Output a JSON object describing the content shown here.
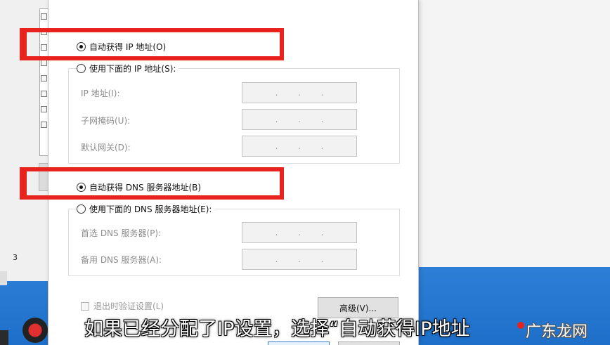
{
  "background": {
    "side_number": "3"
  },
  "dialog": {
    "auto_ip": {
      "label": "自动获得 IP 地址(O)",
      "selected": true
    },
    "manual_ip": {
      "label": "使用下面的 IP 地址(S):",
      "selected": false
    },
    "ip_fields": [
      {
        "label": "IP 地址(I):"
      },
      {
        "label": "子网掩码(U):"
      },
      {
        "label": "默认网关(D):"
      }
    ],
    "auto_dns": {
      "label": "自动获得 DNS 服务器地址(B)",
      "selected": true
    },
    "manual_dns": {
      "label": "使用下面的 DNS 服务器地址(E):",
      "selected": false
    },
    "dns_fields": [
      {
        "label": "首选 DNS 服务器(P):"
      },
      {
        "label": "备用 DNS 服务器(A):"
      }
    ],
    "ip_separator": ".",
    "validate_checkbox": {
      "label": "退出时验证设置(L)",
      "checked": false
    },
    "advanced_button": "高级(V)..."
  },
  "overlay": {
    "subtitle": "如果已经分配了IP设置，选择“自动获得IP地址",
    "watermark": "广东龙网"
  },
  "colors": {
    "highlight": "#e8231e",
    "dialog_bg": "#ffffff",
    "disabled_text": "#8c8c8c",
    "taskbar": "#2d7fd6"
  }
}
